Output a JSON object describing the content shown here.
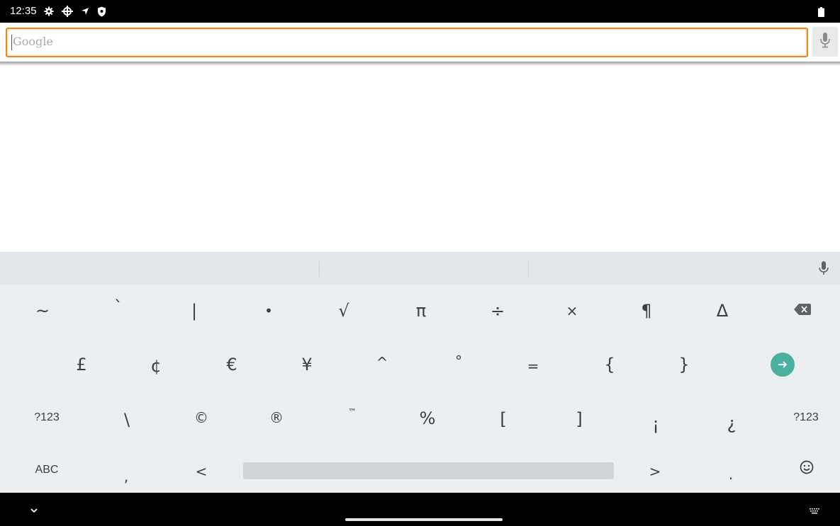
{
  "status_bar": {
    "time": "12:35",
    "icons": [
      "settings-gear-icon",
      "location-target-icon",
      "navigation-arrow-icon",
      "shield-icon"
    ],
    "battery": "battery-icon"
  },
  "search": {
    "placeholder": "Google",
    "value": "",
    "mic": "microphone-icon",
    "accent_color": "#e8891e"
  },
  "keyboard": {
    "suggestion_strip": [
      "",
      "",
      ""
    ],
    "row1": [
      "~",
      "`",
      "|",
      "•",
      "√",
      "π",
      "÷",
      "×",
      "¶",
      "Δ"
    ],
    "row2": [
      "£",
      "¢",
      "€",
      "¥",
      "^",
      "°",
      "=",
      "{",
      "}"
    ],
    "row3": [
      "?123",
      "\\",
      "©",
      "®",
      "™",
      "%",
      "[",
      "]",
      "¡",
      "¿",
      "?123"
    ],
    "row4": [
      "ABC",
      ",",
      "<",
      ">",
      "."
    ],
    "action_color": "#4ab0a0"
  },
  "nav_bar": {
    "hide_keyboard": "chevron-down-icon",
    "switch_keyboard": "keyboard-icon"
  }
}
